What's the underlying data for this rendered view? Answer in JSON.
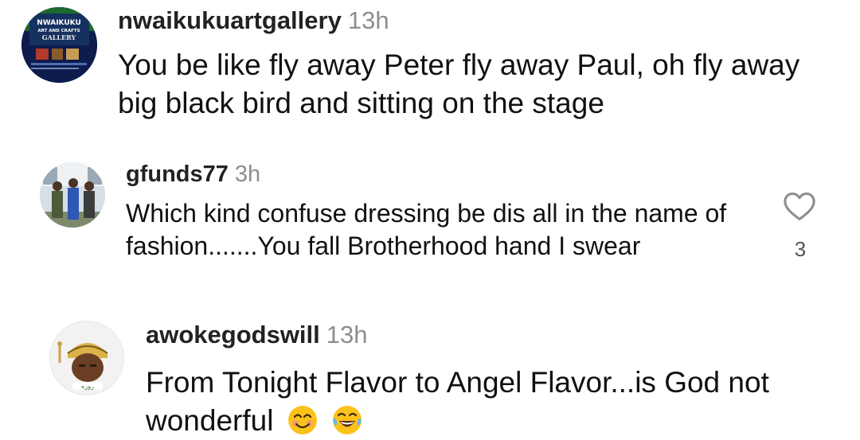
{
  "comments": [
    {
      "username": "nwaikukuartgallery",
      "time": "13h",
      "text": "You be like fly away Peter fly away Paul, oh fly away big black bird and sitting on the stage",
      "avatar_text": [
        "NWAIKUKU",
        "ART AND CRAFTS",
        "GALLERY"
      ]
    },
    {
      "username": "gfunds77",
      "time": "3h",
      "text": "Which kind confuse dressing be dis all in the name of fashion.......You fall Brotherhood hand I swear",
      "like_count": "3"
    },
    {
      "username": "awokegodswill",
      "time": "13h",
      "text": "From Tonight Flavor to Angel Flavor...is God not wonderful",
      "emojis": [
        "smiling-face-icon",
        "tears-of-joy-icon"
      ]
    }
  ],
  "colors": {
    "text": "#111111",
    "username": "#222222",
    "timestamp": "#8e8e8e",
    "heart_outline": "#8e8e8e"
  }
}
